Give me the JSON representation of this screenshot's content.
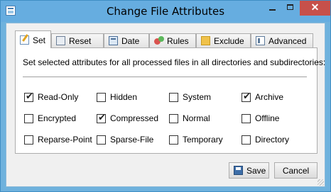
{
  "window": {
    "title": "Change File Attributes",
    "close_glyph": "✕"
  },
  "tabs": [
    {
      "label": "Set",
      "icon": "set-icon",
      "active": true
    },
    {
      "label": "Reset",
      "icon": "reset-icon",
      "active": false
    },
    {
      "label": "Date",
      "icon": "date-icon",
      "active": false
    },
    {
      "label": "Rules",
      "icon": "rules-icon",
      "active": false
    },
    {
      "label": "Exclude",
      "icon": "exclude-icon",
      "active": false
    },
    {
      "label": "Advanced",
      "icon": "advanced-icon",
      "active": false
    }
  ],
  "panel": {
    "description": "Set selected attributes for all processed files in all directories and subdirectories:"
  },
  "attributes": [
    {
      "label": "Read-Only",
      "checked": true
    },
    {
      "label": "Hidden",
      "checked": false
    },
    {
      "label": "System",
      "checked": false
    },
    {
      "label": "Archive",
      "checked": true
    },
    {
      "label": "Encrypted",
      "checked": false
    },
    {
      "label": "Compressed",
      "checked": true
    },
    {
      "label": "Normal",
      "checked": false
    },
    {
      "label": "Offline",
      "checked": false
    },
    {
      "label": "Reparse-Point",
      "checked": false
    },
    {
      "label": "Sparse-File",
      "checked": false
    },
    {
      "label": "Temporary",
      "checked": false
    },
    {
      "label": "Directory",
      "checked": false
    }
  ],
  "buttons": {
    "save_label": "Save",
    "cancel_label": "Cancel"
  },
  "colors": {
    "title_bar": "#66ade0",
    "close_button": "#c7504a"
  }
}
